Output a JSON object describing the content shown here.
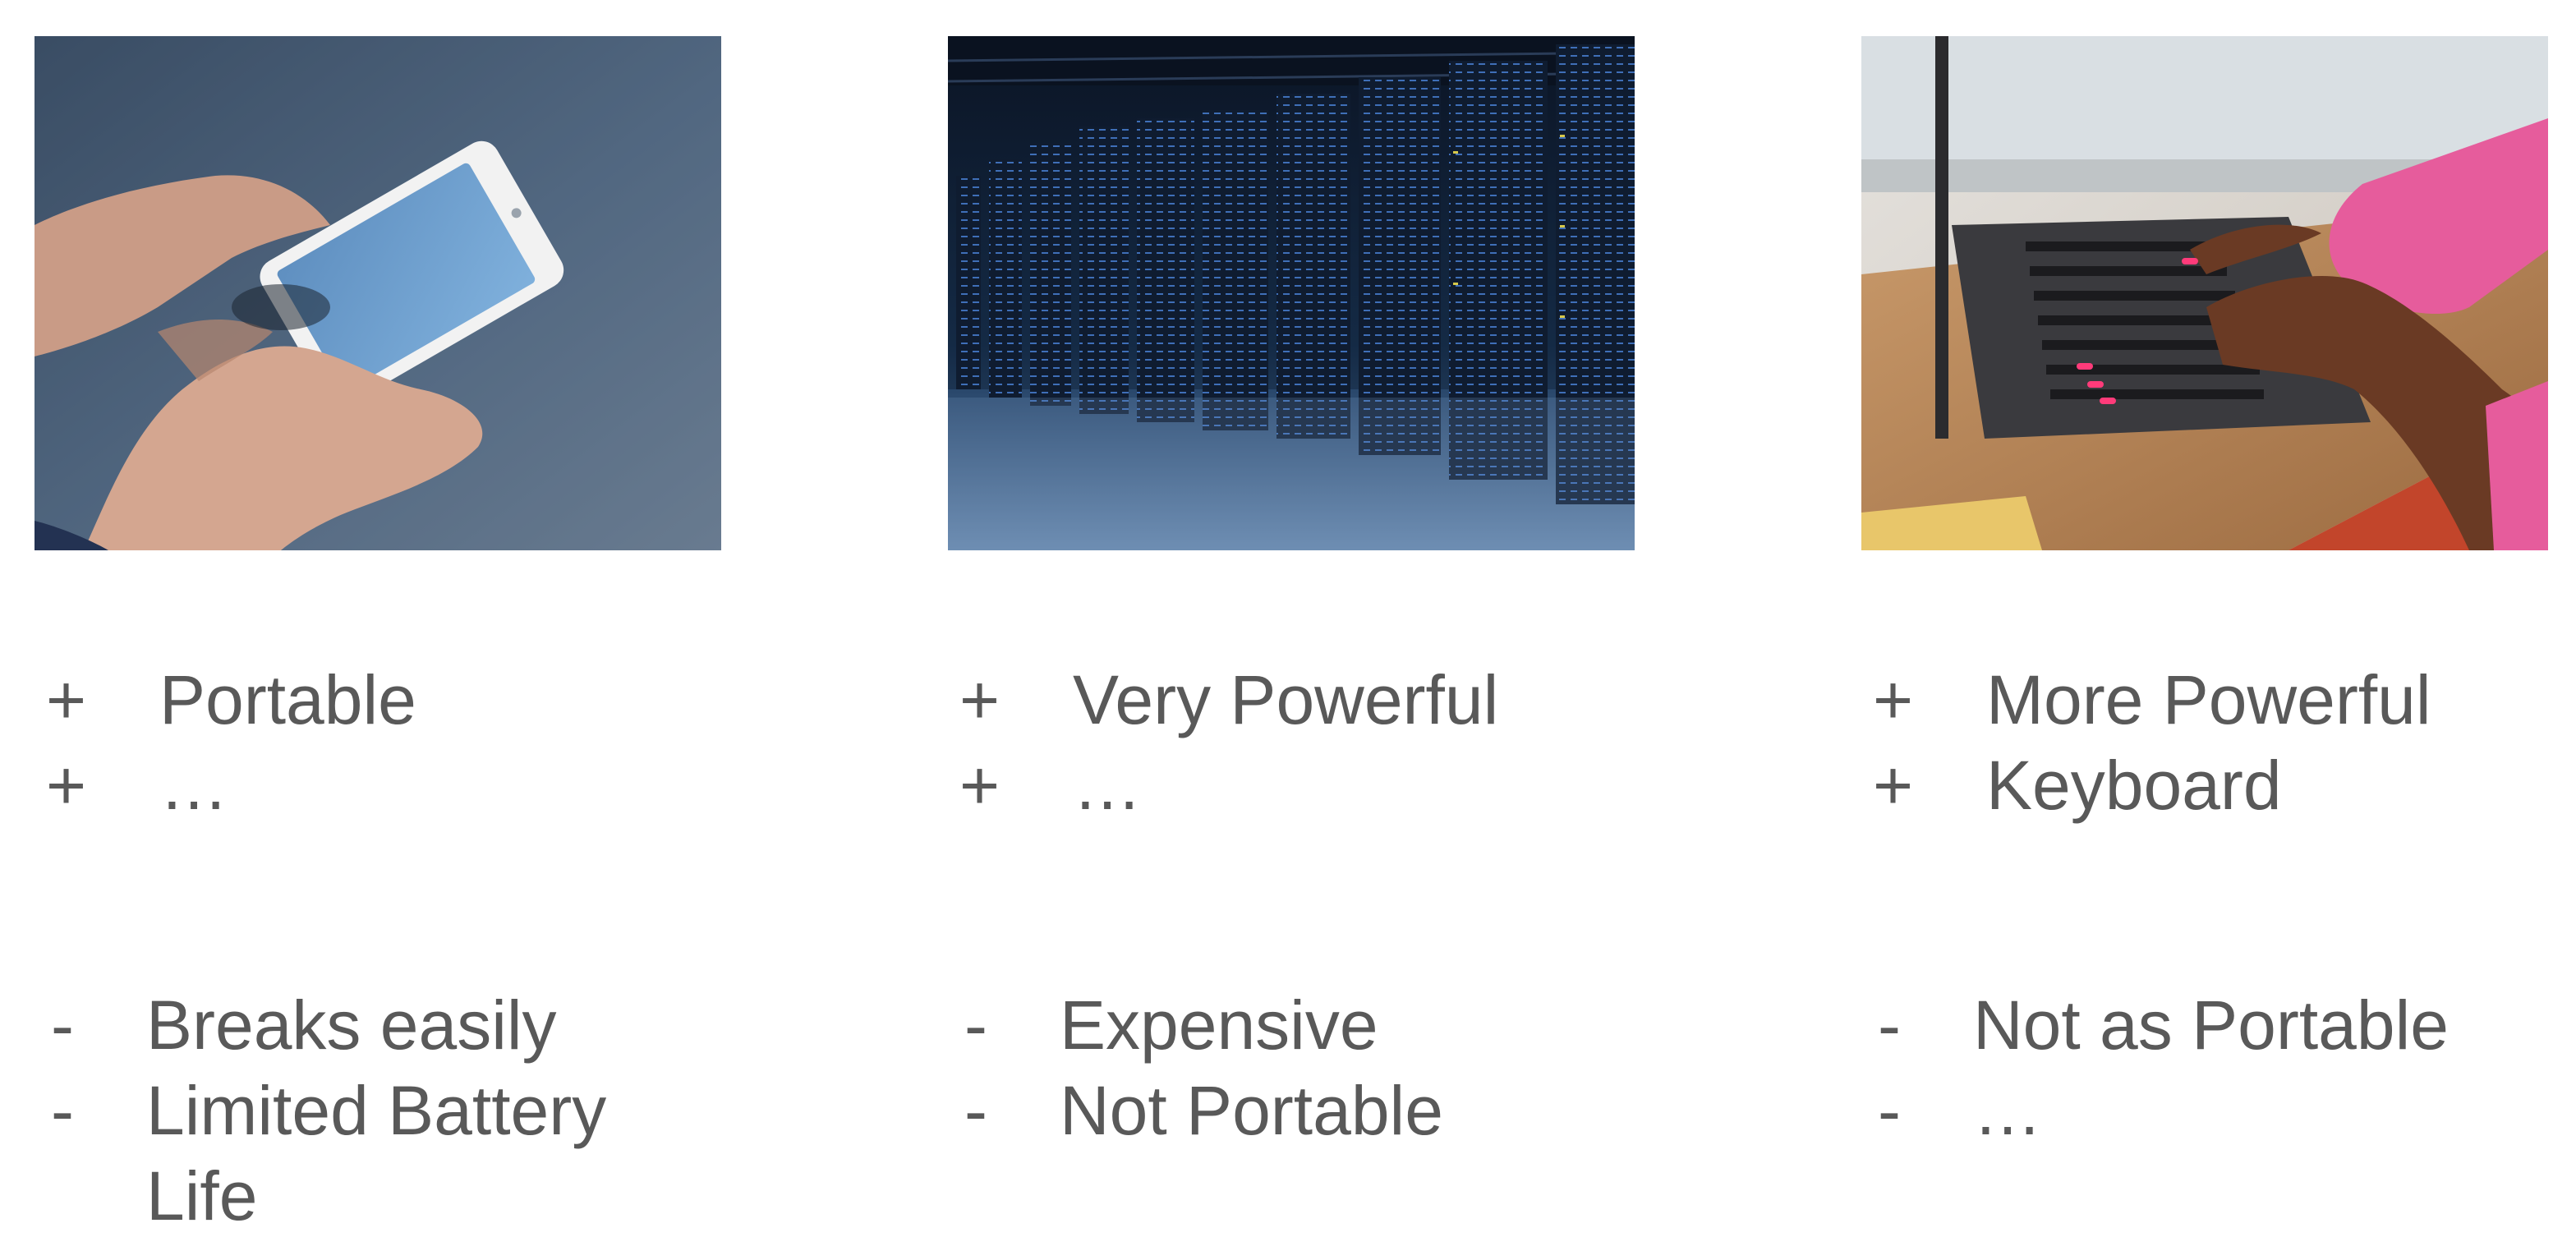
{
  "columns": [
    {
      "id": "smartphone",
      "image": "hands-holding-smartphone-photo",
      "pros": [
        "Portable",
        "…"
      ],
      "cons": [
        "Breaks easily",
        "Limited Battery Life"
      ]
    },
    {
      "id": "server",
      "image": "data-center-server-racks-photo",
      "pros": [
        "Very Powerful",
        "…"
      ],
      "cons": [
        "Expensive",
        "Not Portable"
      ]
    },
    {
      "id": "laptop",
      "image": "hands-typing-on-laptop-photo",
      "pros": [
        "More Powerful",
        "Keyboard"
      ],
      "cons": [
        "Not as Portable",
        "…"
      ]
    }
  ],
  "markers": {
    "pro": "+",
    "con": "-"
  },
  "colors": {
    "text": "#595959"
  }
}
